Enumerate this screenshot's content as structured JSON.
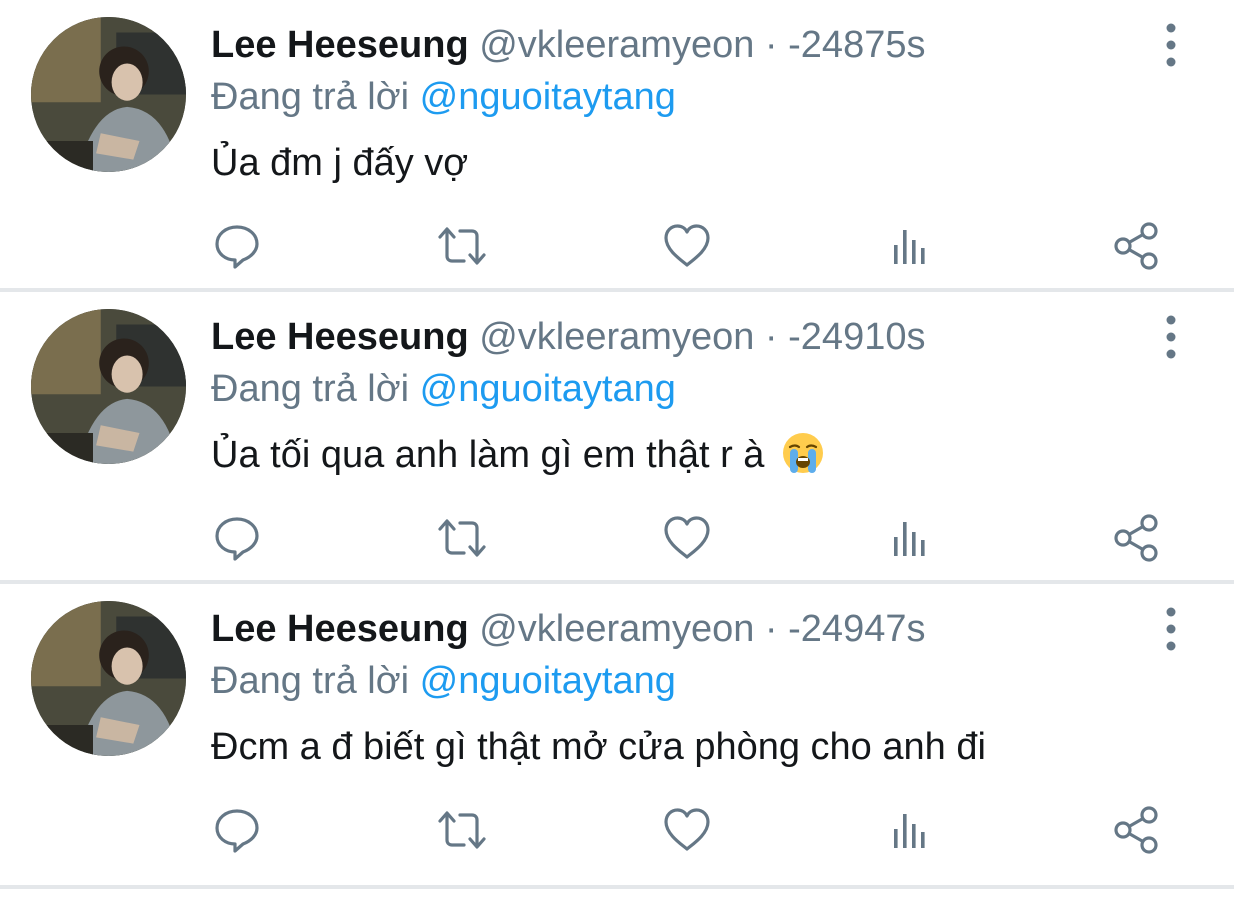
{
  "tweets": [
    {
      "display_name": "Lee Heeseung",
      "handle": "@vkleeramyeon",
      "separator": "·",
      "time": "-24875s",
      "reply_prefix": "Đang trả lời",
      "reply_to": "@nguoitaytang",
      "text": "Ủa đm j đấy vợ",
      "emoji": null
    },
    {
      "display_name": "Lee Heeseung",
      "handle": "@vkleeramyeon",
      "separator": "·",
      "time": "-24910s",
      "reply_prefix": "Đang trả lời",
      "reply_to": "@nguoitaytang",
      "text": "Ủa tối qua anh làm gì em thật r à",
      "emoji": "loudly-crying-face"
    },
    {
      "display_name": "Lee Heeseung",
      "handle": "@vkleeramyeon",
      "separator": "·",
      "time": "-24947s",
      "reply_prefix": "Đang trả lời",
      "reply_to": "@nguoitaytang",
      "text": "Đcm a đ biết gì thật mở cửa phòng cho anh đi",
      "emoji": null
    }
  ],
  "icons": {
    "reply": "comment-bubble-icon",
    "retweet": "retweet-arrows-icon",
    "like": "heart-icon",
    "stats": "bar-chart-icon",
    "share": "share-nodes-icon",
    "more": "vertical-dots-icon"
  },
  "colors": {
    "name": "#14171a",
    "muted": "#657786",
    "link": "#1d9bf0",
    "divider": "#e4e7ea"
  }
}
